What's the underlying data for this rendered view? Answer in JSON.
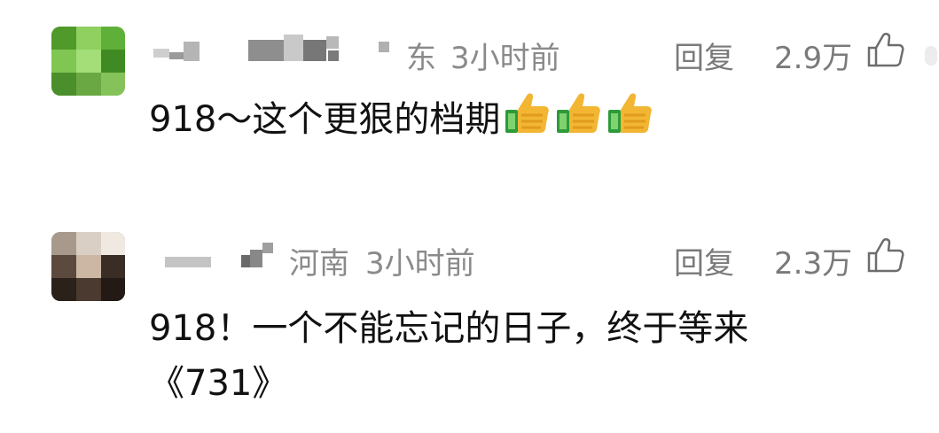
{
  "comments": [
    {
      "location": "东",
      "time": "3小时前",
      "reply_label": "回复",
      "likes": "2.9万",
      "text": "918～这个更狠的档期",
      "emoji": [
        "thumbs-up",
        "thumbs-up",
        "thumbs-up"
      ]
    },
    {
      "location": "河南",
      "time": "3小时前",
      "reply_label": "回复",
      "likes": "2.3万",
      "text_line1": "918！一个不能忘记的日子，终于等来",
      "text_line2": "《731》"
    }
  ],
  "colors": {
    "text": "#111111",
    "meta": "#8a8a8a",
    "action": "#7a7a7a"
  }
}
